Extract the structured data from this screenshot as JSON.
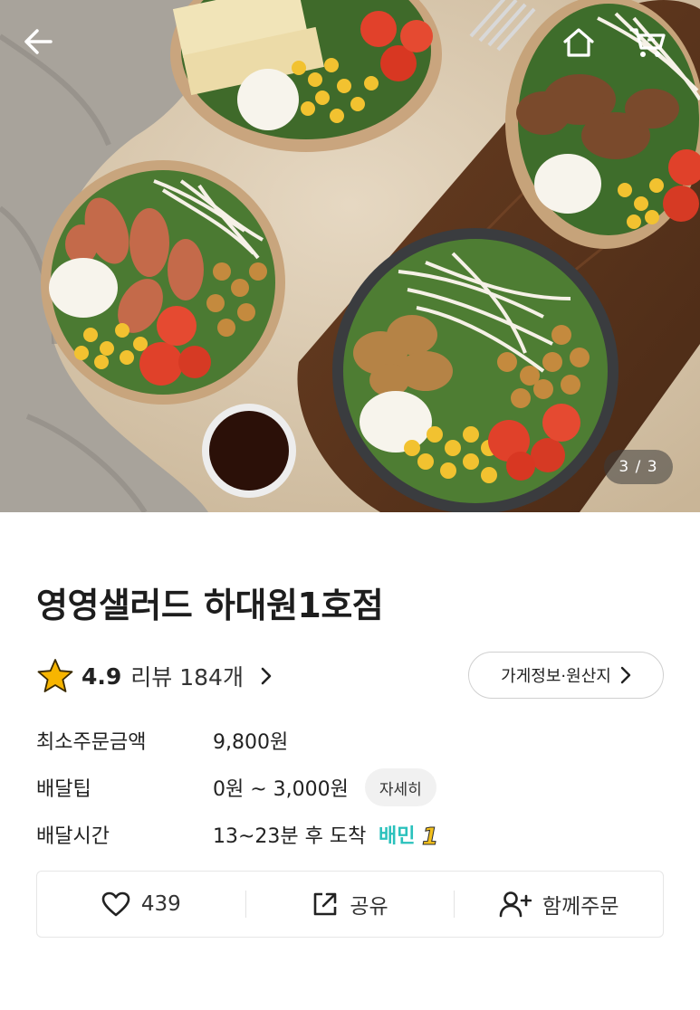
{
  "hero": {
    "page_indicator": "3 / 3",
    "icons": {
      "back": "arrow-left-icon",
      "home": "home-icon",
      "cart": "cart-icon"
    }
  },
  "store": {
    "name": "영영샐러드 하대원1호점",
    "rating": "4.9",
    "review_label": "리뷰 184개",
    "info_button": "가게정보·원산지"
  },
  "details": {
    "min_order": {
      "label": "최소주문금액",
      "value": "9,800원"
    },
    "delivery_tip": {
      "label": "배달팁",
      "value": "0원 ~ 3,000원",
      "button": "자세히"
    },
    "delivery_time": {
      "label": "배달시간",
      "value": "13~23분 후 도착",
      "badge": "배민1"
    }
  },
  "actions": {
    "like_count": "439",
    "share_label": "공유",
    "group_order_label": "함께주문"
  },
  "colors": {
    "star": "#f7b500",
    "badge_mint": "#2ac1bc",
    "badge_yellow": "#f3c01c",
    "text": "#222222",
    "border": "#e6e6e6"
  }
}
